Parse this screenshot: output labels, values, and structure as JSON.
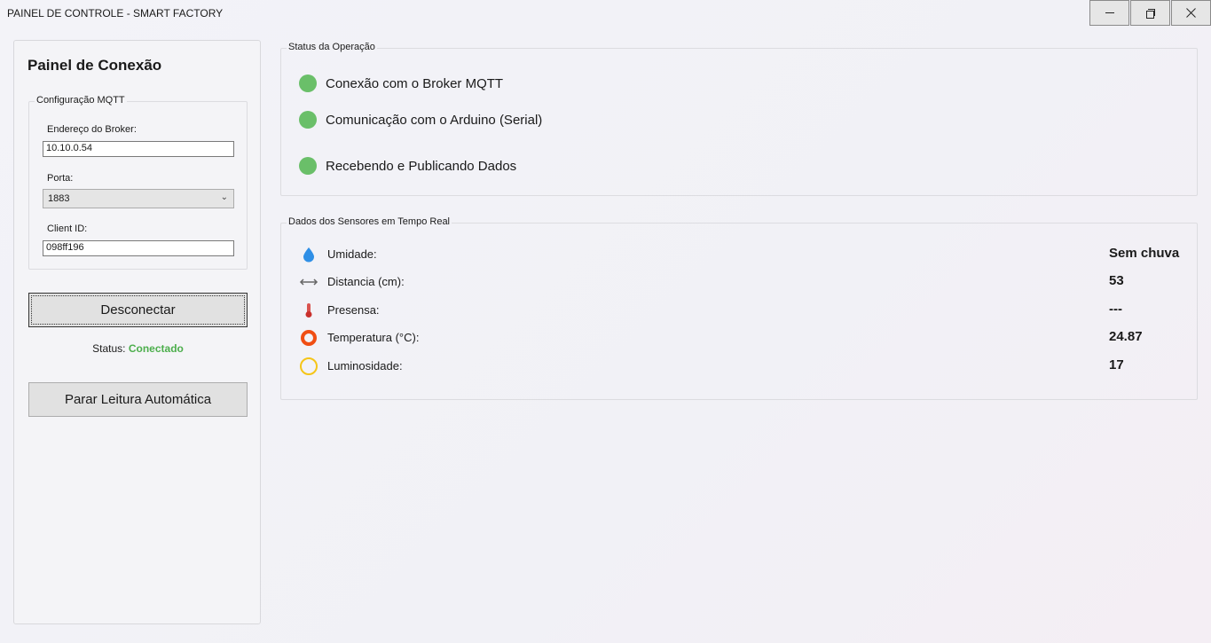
{
  "window": {
    "title": "PAINEL DE CONTROLE - SMART FACTORY"
  },
  "connection_panel": {
    "title": "Painel de Conexão",
    "mqtt_group": {
      "legend": "Configuração MQTT",
      "broker_label": "Endereço do Broker:",
      "broker_value": "10.10.0.54",
      "port_label": "Porta:",
      "port_value": "1883",
      "client_id_label": "Client ID:",
      "client_id_value": "098ff196"
    },
    "disconnect_label": "Desconectar",
    "status_label": "Status:",
    "status_value": "Conectado",
    "status_color": "#4cae4c",
    "stop_reading_label": "Parar Leitura Automática"
  },
  "operation_status": {
    "legend": "Status da Operação",
    "items": [
      {
        "label": "Conexão com o Broker MQTT",
        "color": "#6abf69"
      },
      {
        "label": "Comunicação com o Arduino (Serial)",
        "color": "#6abf69"
      },
      {
        "label": "Recebendo e Publicando Dados",
        "color": "#6abf69"
      }
    ]
  },
  "sensors": {
    "legend": "Dados dos Sensores em Tempo Real",
    "items": [
      {
        "icon": "water-drop-icon",
        "label": "Umidade:",
        "value": "Sem chuva"
      },
      {
        "icon": "distance-arrows-icon",
        "label": "Distancia (cm):",
        "value": "53"
      },
      {
        "icon": "thermometer-icon",
        "label": "Presensa:",
        "value": "---"
      },
      {
        "icon": "temperature-ring-icon",
        "label": "Temperatura (°C):",
        "value": "24.87"
      },
      {
        "icon": "light-ring-icon",
        "label": "Luminosidade:",
        "value": "17"
      }
    ]
  }
}
